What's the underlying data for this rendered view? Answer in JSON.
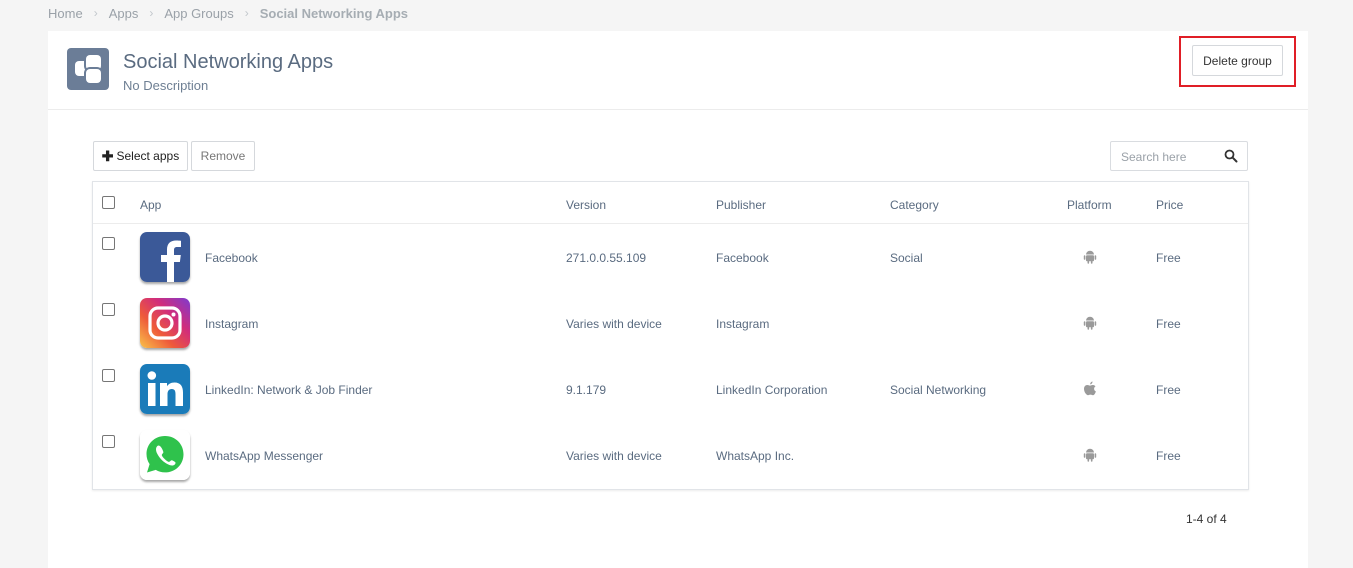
{
  "breadcrumb": {
    "items": [
      "Home",
      "Apps",
      "App Groups"
    ],
    "current": "Social Networking Apps"
  },
  "group": {
    "title": "Social Networking Apps",
    "description": "No Description",
    "icon": "app-group-icon"
  },
  "actions": {
    "delete_label": "Delete group",
    "select_label": "Select apps",
    "remove_label": "Remove"
  },
  "search": {
    "placeholder": "Search here",
    "value": ""
  },
  "table": {
    "columns": [
      "App",
      "Version",
      "Publisher",
      "Category",
      "Platform",
      "Price"
    ],
    "rows": [
      {
        "name": "Facebook",
        "version": "271.0.0.55.109",
        "publisher": "Facebook",
        "category": "Social",
        "platform": "android",
        "price": "Free",
        "icon": "facebook-logo-icon"
      },
      {
        "name": "Instagram",
        "version": "Varies with device",
        "publisher": "Instagram",
        "category": "",
        "platform": "android",
        "price": "Free",
        "icon": "instagram-logo-icon"
      },
      {
        "name": "LinkedIn: Network & Job Finder",
        "version": "9.1.179",
        "publisher": "LinkedIn Corporation",
        "category": "Social Networking",
        "platform": "apple",
        "price": "Free",
        "icon": "linkedin-logo-icon"
      },
      {
        "name": "WhatsApp Messenger",
        "version": "Varies with device",
        "publisher": "WhatsApp Inc.",
        "category": "",
        "platform": "android",
        "price": "Free",
        "icon": "whatsapp-logo-icon"
      }
    ]
  },
  "pagination": {
    "summary": "1-4 of 4"
  },
  "colors": {
    "highlight": "#e01e26",
    "group_icon_bg": "#6b7d97",
    "text": "#5a6b80",
    "page_bg": "#f5f5f5"
  }
}
